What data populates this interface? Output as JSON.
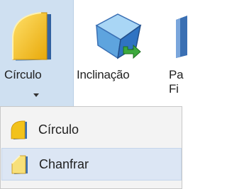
{
  "ribbon": {
    "buttons": [
      {
        "label": "Círculo",
        "icon": "circle-fillet-icon"
      },
      {
        "label": "Inclinação",
        "icon": "inclination-box-icon"
      },
      {
        "label_line1": "Pa",
        "label_line2": "Fi",
        "icon": "partial-icon"
      }
    ]
  },
  "dropdown": {
    "items": [
      {
        "label": "Círculo",
        "icon": "circle-fillet-small-icon"
      },
      {
        "label": "Chanfrar",
        "icon": "chamfer-small-icon"
      }
    ]
  },
  "colors": {
    "selected_bg": "#cfe0f1",
    "hover_bg": "#dce6f4",
    "icon_yellow": "#f2c21b",
    "icon_blue": "#3a6fb3"
  }
}
